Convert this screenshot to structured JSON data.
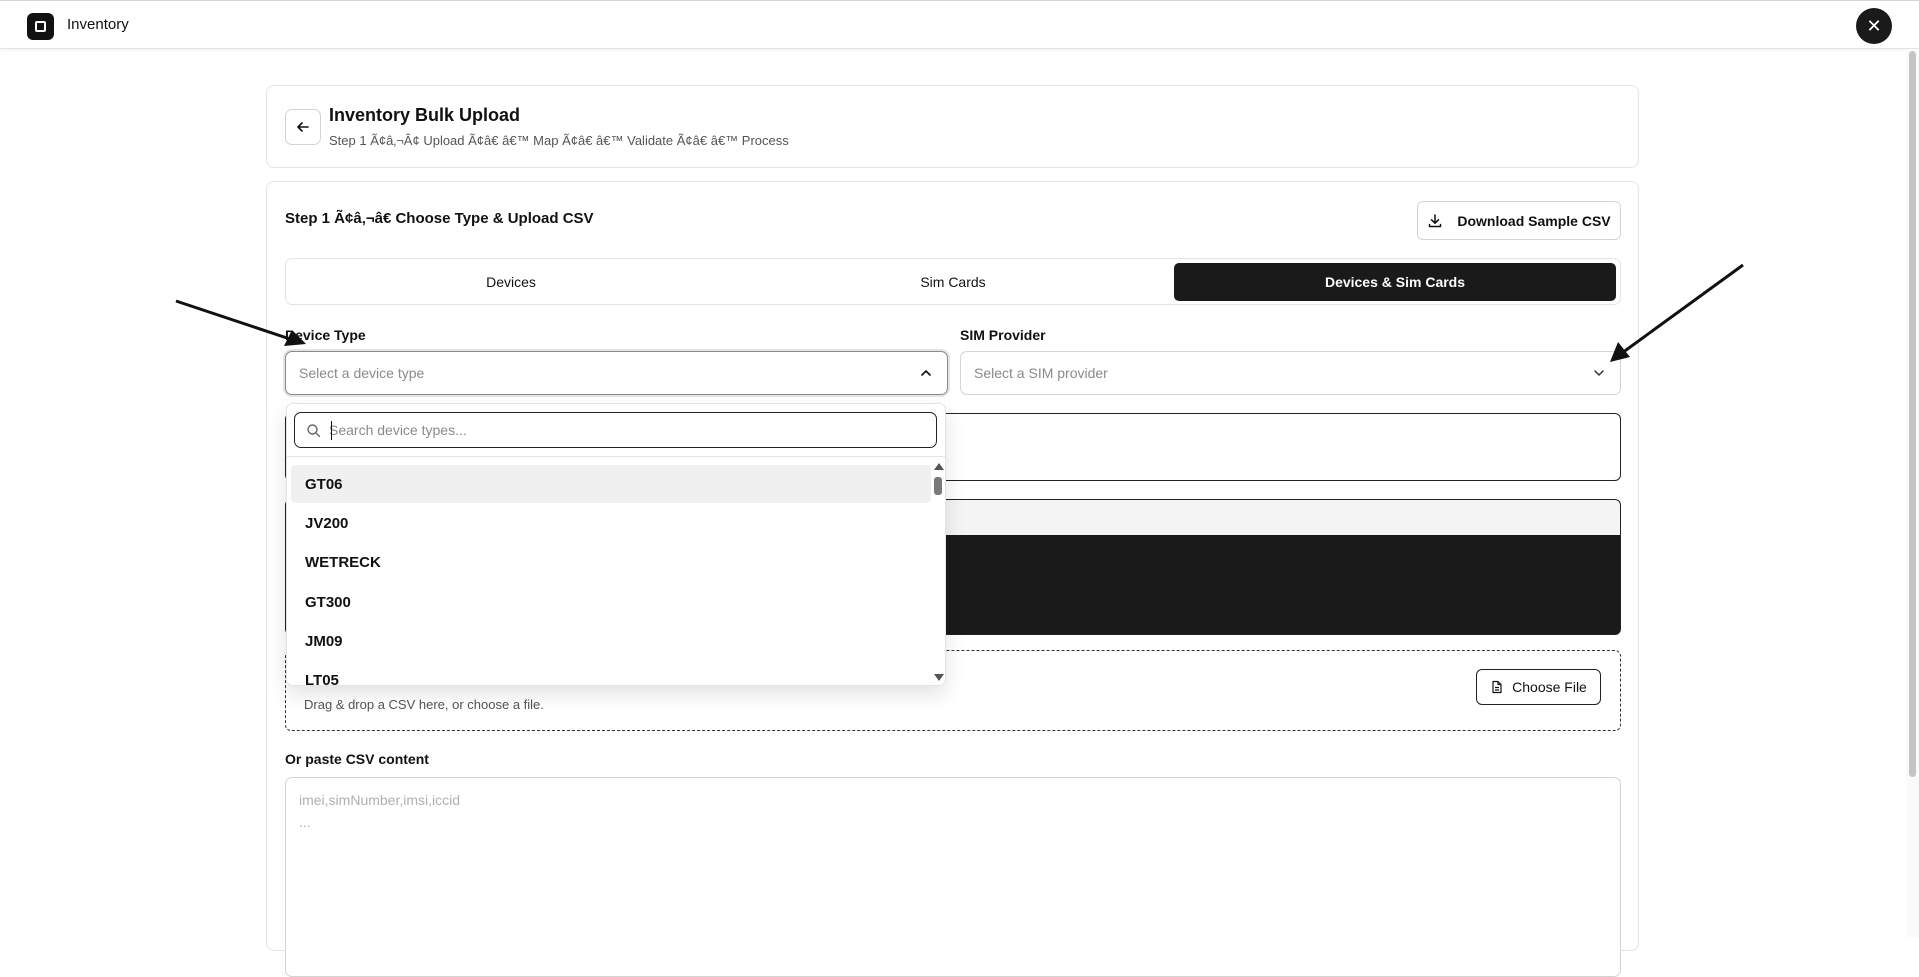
{
  "app": {
    "title": "Inventory",
    "close_glyph": "✕"
  },
  "header": {
    "title": "Inventory Bulk Upload",
    "subtitle": "Step 1 Ã¢â‚¬Â¢ Upload Ã¢â€ â€™ Map Ã¢â€ â€™ Validate Ã¢â€ â€™ Process"
  },
  "step": {
    "title": "Step 1 Ã¢â‚¬â€ Choose Type & Upload CSV",
    "download_label": "Download Sample CSV"
  },
  "tabs": [
    {
      "label": "Devices",
      "active": false
    },
    {
      "label": "Sim Cards",
      "active": false
    },
    {
      "label": "Devices & Sim Cards",
      "active": true
    }
  ],
  "device_type": {
    "label": "Device Type",
    "placeholder": "Select a device type",
    "search_placeholder": "Search device types...",
    "options": [
      "GT06",
      "JV200",
      "WETRECK",
      "GT300",
      "JM09",
      "LT05"
    ]
  },
  "sim_provider": {
    "label": "SIM Provider",
    "placeholder": "Select a SIM provider"
  },
  "upload": {
    "hint": "Drag & drop a CSV here, or choose a file.",
    "choose_label": "Choose File"
  },
  "paste": {
    "label": "Or paste CSV content",
    "placeholder_line1": "imei,simNumber,imsi,iccid",
    "placeholder_line2": "..."
  },
  "colors": {
    "dark": "#1a1a1a",
    "border": "#d4d4d8",
    "muted": "#8a8a8a"
  },
  "icons": [
    "app-logo-icon",
    "close-icon",
    "arrow-left-icon",
    "download-icon",
    "chevron-up-icon",
    "chevron-down-icon",
    "search-icon",
    "file-icon"
  ]
}
